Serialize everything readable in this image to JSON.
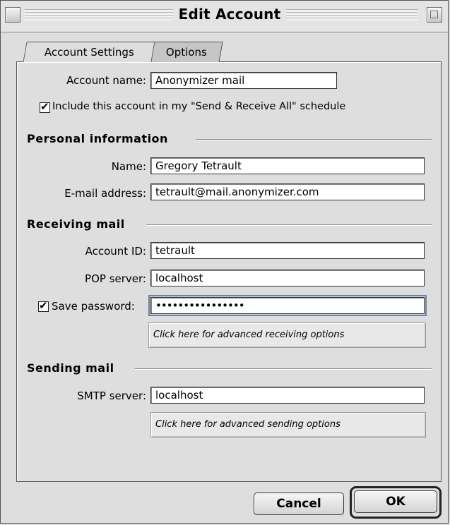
{
  "window": {
    "title": "Edit Account"
  },
  "tabs": [
    {
      "label": "Account Settings",
      "active": true
    },
    {
      "label": "Options",
      "active": false
    }
  ],
  "account": {
    "name_label": "Account name:",
    "name_value": "Anonymizer mail",
    "include_checkbox_label": "Include this account in my \"Send & Receive All\" schedule",
    "include_checked": true
  },
  "personal": {
    "heading": "Personal information",
    "name_label": "Name:",
    "name_value": "Gregory Tetrault",
    "email_label": "E-mail address:",
    "email_value": "tetrault@mail.anonymizer.com"
  },
  "receiving": {
    "heading": "Receiving mail",
    "account_id_label": "Account ID:",
    "account_id_value": "tetrault",
    "pop_label": "POP server:",
    "pop_value": "localhost",
    "save_password_label": "Save password:",
    "save_password_checked": true,
    "password_value": "••••••••••••••••",
    "advanced_label": "Click here for advanced receiving options"
  },
  "sending": {
    "heading": "Sending mail",
    "smtp_label": "SMTP server:",
    "smtp_value": "localhost",
    "advanced_label": "Click here for advanced sending options"
  },
  "buttons": {
    "cancel": "Cancel",
    "ok": "OK"
  }
}
